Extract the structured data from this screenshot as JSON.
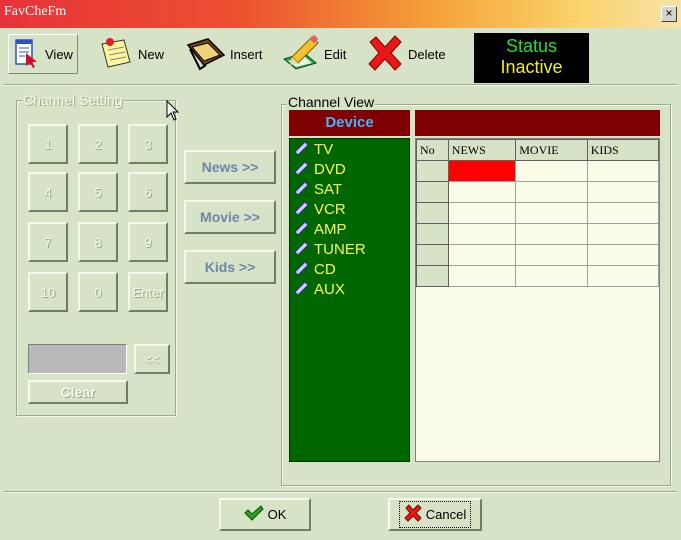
{
  "window": {
    "title": "FavCheFm",
    "close_glyph": "×"
  },
  "toolbar": {
    "items": [
      {
        "label": "View",
        "icon": "view-icon"
      },
      {
        "label": "New",
        "icon": "new-note-icon"
      },
      {
        "label": "Insert",
        "icon": "folder-insert-icon"
      },
      {
        "label": "Edit",
        "icon": "edit-pencil-icon"
      },
      {
        "label": "Delete",
        "icon": "delete-x-icon"
      }
    ],
    "status": {
      "line1": "Status",
      "line2": "Inactive"
    }
  },
  "channel_setting": {
    "title": "Channel Setting",
    "keys": [
      "1",
      "2",
      "3",
      "4",
      "5",
      "6",
      "7",
      "8",
      "9",
      "10",
      "0",
      "Enter"
    ],
    "backspace_label": "<<",
    "clear_label": "Clear",
    "display_value": ""
  },
  "category_buttons": [
    "News >>",
    "Movie >>",
    "Kids >>"
  ],
  "channel_view": {
    "title": "Channel View",
    "device_header": "Device",
    "devices": [
      "TV",
      "DVD",
      "SAT",
      "VCR",
      "AMP",
      "TUNER",
      "CD",
      "AUX"
    ],
    "columns": [
      "No",
      "NEWS",
      "MOVIE",
      "KIDS"
    ],
    "rows": [
      [
        "",
        "",
        "",
        ""
      ],
      [
        "",
        "",
        "",
        ""
      ],
      [
        "",
        "",
        "",
        ""
      ],
      [
        "",
        "",
        "",
        ""
      ],
      [
        "",
        "",
        "",
        ""
      ],
      [
        "",
        "",
        "",
        ""
      ]
    ]
  },
  "footer": {
    "ok_label": "OK",
    "cancel_label": "Cancel"
  },
  "colors": {
    "background": "#d6e3c6",
    "device_header_bg": "#7e0000",
    "device_header_text": "#3fb4ff",
    "device_list_bg": "#006600",
    "device_text": "#fafa56",
    "selected_cell": "#ff0000",
    "status_active_text": "#22e32a",
    "status_inactive_text": "#f0ec30"
  }
}
